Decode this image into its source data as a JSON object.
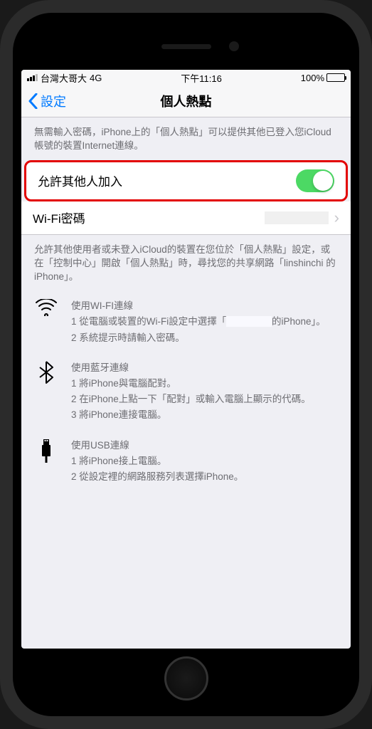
{
  "statusBar": {
    "carrier": "台灣大哥大",
    "network": "4G",
    "time": "下午11:16",
    "battery": "100%"
  },
  "nav": {
    "back": "設定",
    "title": "個人熱點"
  },
  "intro": "無需輸入密碼，iPhone上的「個人熱點」可以提供其他已登入您iCloud帳號的裝置Internet連線。",
  "rows": {
    "allowOthers": "允許其他人加入",
    "wifiPassword": "Wi-Fi密碼"
  },
  "desc2": "允許其他使用者或未登入iCloud的裝置在您位於「個人熱點」設定，或在「控制中心」開啟「個人熱點」時，尋找您的共享網路「linshinchi 的 iPhone」。",
  "wifi": {
    "title": "使用WI-FI連線",
    "step1a": "1 從電腦或裝置的Wi-Fi設定中選擇「",
    "step1b": "的iPhone」。",
    "step2": "2 系統提示時請輸入密碼。"
  },
  "bluetooth": {
    "title": "使用藍牙連線",
    "step1": "1 將iPhone與電腦配對。",
    "step2": "2 在iPhone上點一下「配對」或輸入電腦上顯示的代碼。",
    "step3": "3 將iPhone連接電腦。"
  },
  "usb": {
    "title": "使用USB連線",
    "step1": "1 將iPhone接上電腦。",
    "step2": "2 從設定裡的網路服務列表選擇iPhone。"
  }
}
